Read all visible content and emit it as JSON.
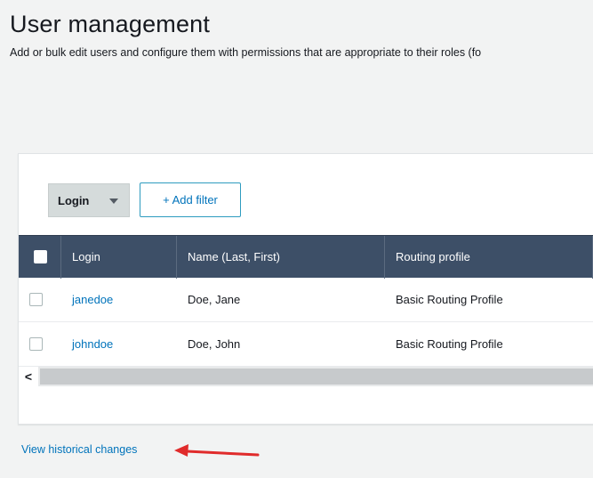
{
  "header": {
    "title": "User management",
    "subtitle": "Add or bulk edit users and configure them with permissions that are appropriate to their roles (fo"
  },
  "filters": {
    "select_value": "Login",
    "add_filter_label": "+ Add filter"
  },
  "table": {
    "columns": [
      "Login",
      "Name (Last, First)",
      "Routing profile"
    ],
    "rows": [
      {
        "login": "janedoe",
        "name": "Doe, Jane",
        "routing_profile": "Basic Routing Profile"
      },
      {
        "login": "johndoe",
        "name": "Doe, John",
        "routing_profile": "Basic Routing Profile"
      }
    ]
  },
  "scrollbar": {
    "left_arrow": "<"
  },
  "footer": {
    "history_link": "View historical changes"
  },
  "colors": {
    "header_bg": "#3d4f67",
    "link": "#0073bb",
    "annotation_arrow": "#e02b2b"
  },
  "icons": [
    "chevron-down-icon",
    "checkbox-icon",
    "scroll-left-icon",
    "annotation-arrow-icon"
  ]
}
